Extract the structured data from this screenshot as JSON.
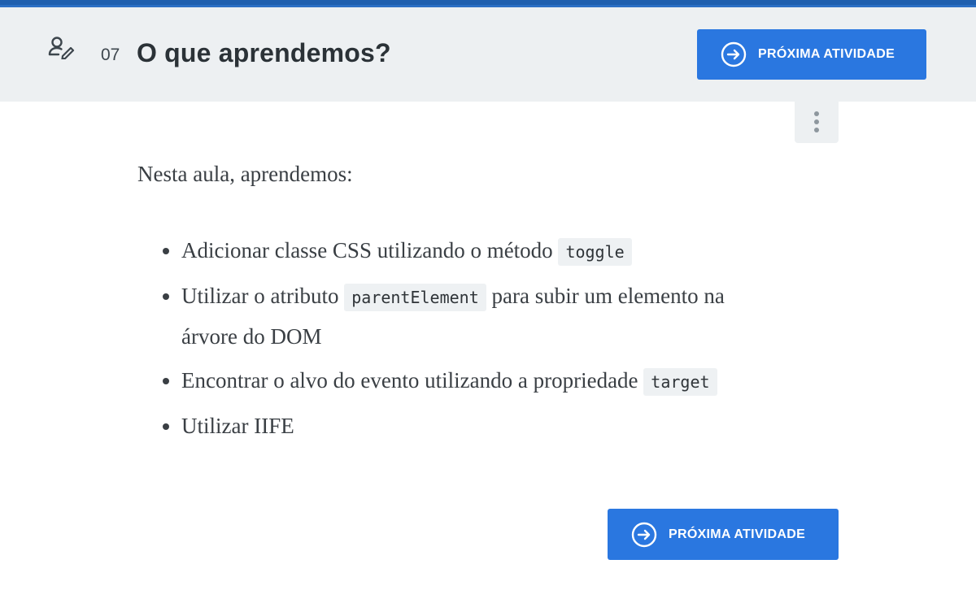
{
  "header": {
    "lesson_number": "07",
    "title": "O que aprendemos?",
    "next_button_label": "PRÓXIMA ATIVIDADE"
  },
  "content": {
    "intro": "Nesta aula, aprendemos:",
    "items": [
      {
        "before": "Adicionar classe CSS utilizando o método ",
        "code": "toggle",
        "after": ""
      },
      {
        "before": "Utilizar o atributo ",
        "code": "parentElement",
        "after": " para subir um elemento na árvore do DOM"
      },
      {
        "before": "Encontrar o alvo do evento utilizando a propriedade ",
        "code": "target",
        "after": ""
      },
      {
        "before": "Utilizar IIFE",
        "code": "",
        "after": ""
      }
    ]
  },
  "footer": {
    "next_button_label": "PRÓXIMA ATIVIDADE"
  },
  "icons": {
    "task": "task-edit-icon",
    "next": "arrow-right-circle-icon",
    "more": "more-vertical-icon"
  },
  "colors": {
    "accent": "#2a77e0",
    "header_bg": "#edf0f2",
    "top_stripe": "#1f5fae"
  }
}
